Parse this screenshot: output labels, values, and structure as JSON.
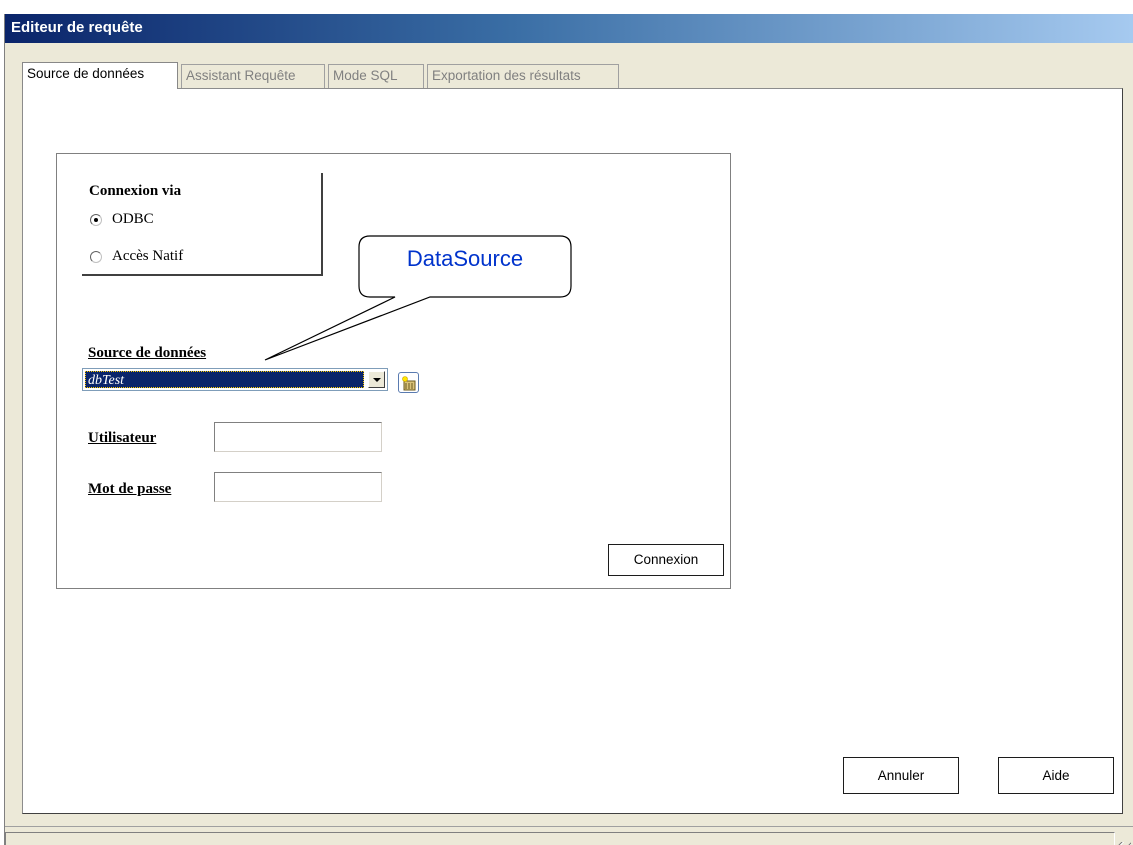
{
  "window": {
    "title": "Editeur de requête"
  },
  "tabs": [
    {
      "label": "Source de données"
    },
    {
      "label": "Assistant Requête"
    },
    {
      "label": "Mode SQL"
    },
    {
      "label": "Exportation des résultats"
    }
  ],
  "connection": {
    "title": "Connexion via",
    "options": [
      {
        "label": "ODBC",
        "checked": true
      },
      {
        "label": "Accès Natif",
        "checked": false
      }
    ]
  },
  "datasource": {
    "label": "Source de données",
    "selected": "dbTest"
  },
  "user": {
    "label": "Utilisateur",
    "value": ""
  },
  "password": {
    "label": "Mot de passe",
    "value": ""
  },
  "buttons": {
    "connect": "Connexion",
    "cancel": "Annuler",
    "help": "Aide"
  },
  "callout": {
    "text": "DataSource",
    "color": "#0033cc"
  },
  "icons": {
    "new_datasource": "new-datasource-icon",
    "dropdown": "chevron-down-icon",
    "grip": "resize-grip-icon"
  }
}
